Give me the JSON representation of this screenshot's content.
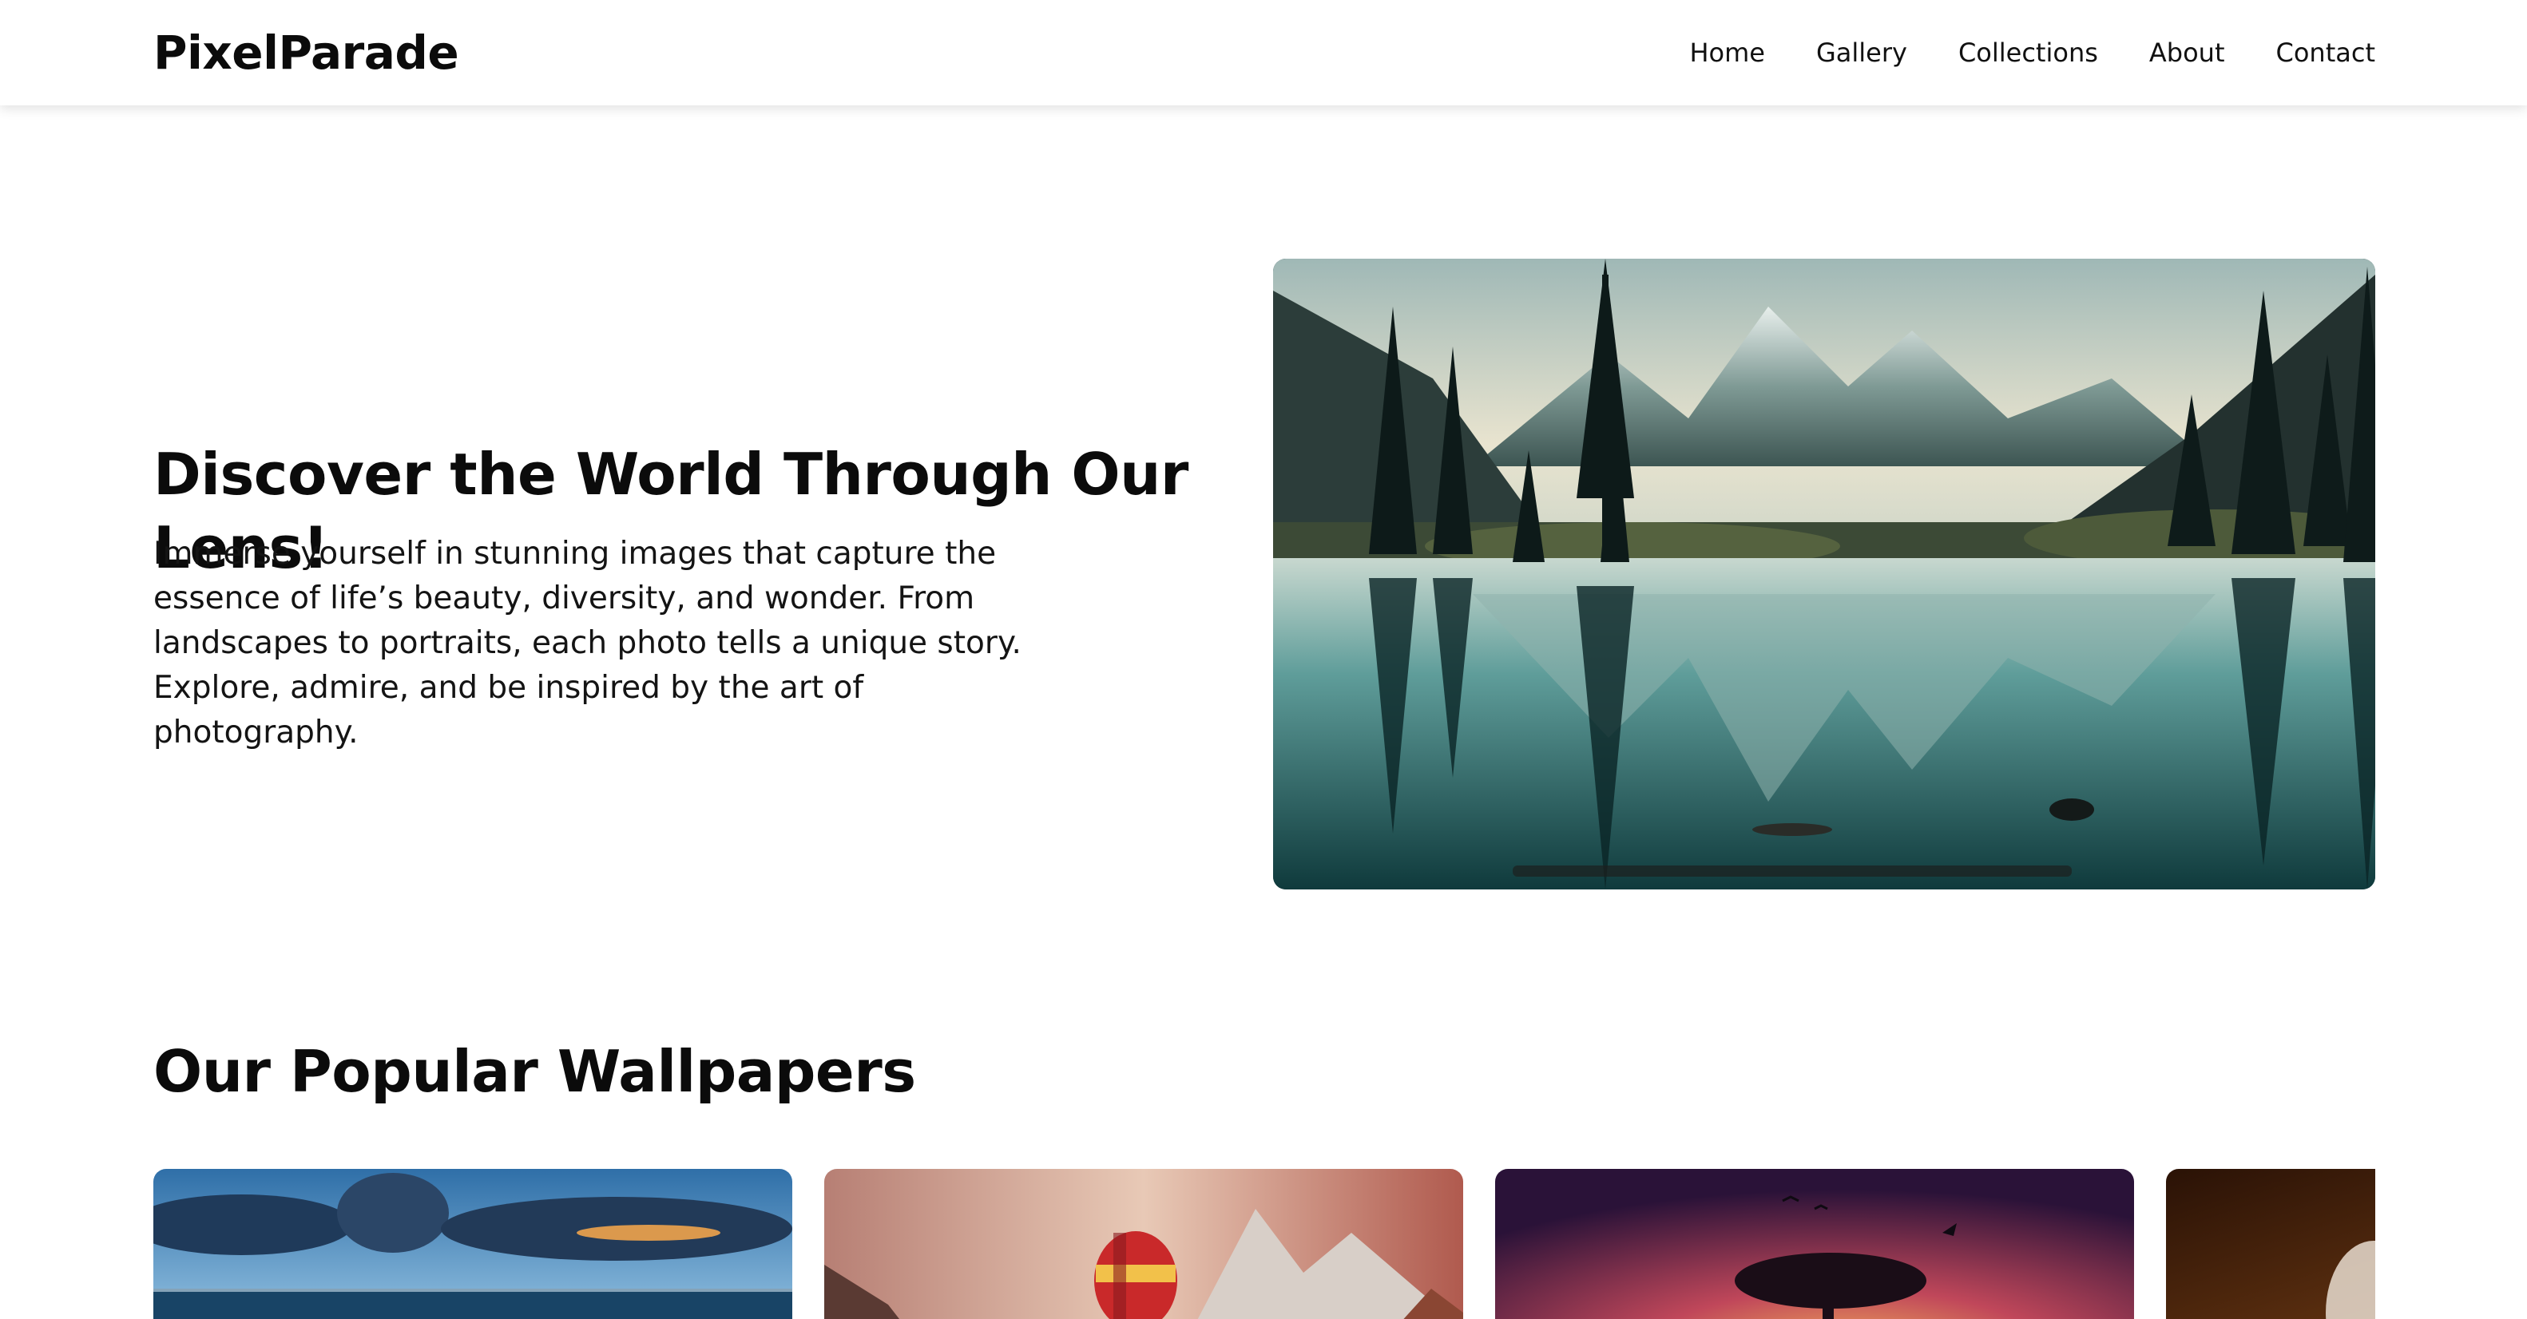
{
  "brand": {
    "name": "PixelParade"
  },
  "nav": {
    "items": [
      {
        "label": "Home"
      },
      {
        "label": "Gallery"
      },
      {
        "label": "Collections"
      },
      {
        "label": "About"
      },
      {
        "label": "Contact"
      }
    ]
  },
  "hero": {
    "title": "Discover the World Through Our Lens!",
    "text": "Immerse yourself in stunning images that capture the essence of life’s beauty, diversity, and wonder. From landscapes to portraits, each photo tells a unique story. Explore, admire, and be inspired by the art of photography."
  },
  "popular": {
    "title": "Our Popular Wallpapers"
  },
  "colors": {
    "text": "#0b0b0b",
    "background": "#ffffff",
    "lake_teal": "#2f6e6e",
    "sunset_orange": "#e08a3c",
    "sunset_purple": "#5a1f4e"
  }
}
